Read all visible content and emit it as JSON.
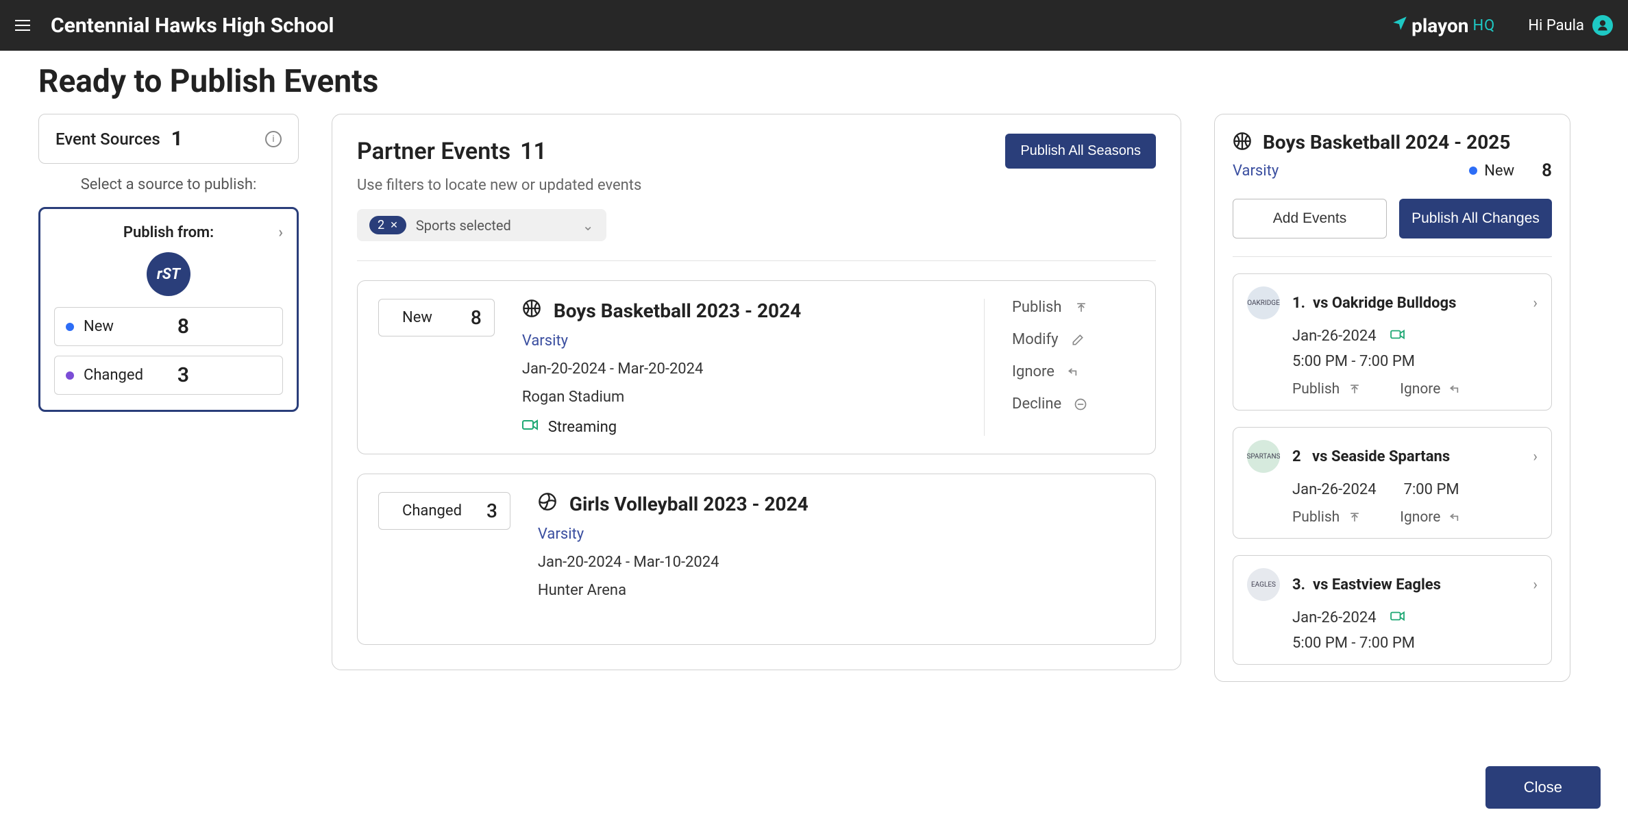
{
  "header": {
    "school": "Centennial Hawks High School",
    "brand_main": "playon",
    "brand_suffix": "HQ",
    "greeting": "Hi Paula"
  },
  "page_title": "Ready to Publish Events",
  "sources_panel": {
    "label": "Event Sources",
    "count": "1",
    "instruction": "Select a source to publish:",
    "publish_from": "Publish from:",
    "source_logo_text": "rST",
    "new_label": "New",
    "new_count": "8",
    "changed_label": "Changed",
    "changed_count": "3"
  },
  "center": {
    "title": "Partner Events",
    "count": "11",
    "publish_all_btn": "Publish All Seasons",
    "subtitle": "Use filters to locate new or updated events",
    "filter_count": "2",
    "filter_label": "Sports selected",
    "events": [
      {
        "status_kind": "new",
        "status_label": "New",
        "status_count": "8",
        "sport": "basketball",
        "title": "Boys Basketball 2023 - 2024",
        "level": "Varsity",
        "dates": "Jan-20-2024 - Mar-20-2024",
        "venue": "Rogan Stadium",
        "streaming": "Streaming",
        "actions": {
          "publish": "Publish",
          "modify": "Modify",
          "ignore": "Ignore",
          "decline": "Decline"
        }
      },
      {
        "status_kind": "changed",
        "status_label": "Changed",
        "status_count": "3",
        "sport": "volleyball",
        "title": "Girls Volleyball 2023 - 2024",
        "level": "Varsity",
        "dates": "Jan-20-2024 - Mar-10-2024",
        "venue": "Hunter Arena"
      }
    ]
  },
  "right": {
    "title": "Boys Basketball 2024 - 2025",
    "level": "Varsity",
    "status_label": "New",
    "count": "8",
    "add_btn": "Add Events",
    "publish_btn": "Publish All Changes",
    "games": [
      {
        "num": "1.",
        "opponent": "vs Oakridge Bulldogs",
        "date": "Jan-26-2024",
        "has_stream": true,
        "time": "5:00 PM - 7:00 PM",
        "publish": "Publish",
        "ignore": "Ignore",
        "badge": "OAKRIDGE"
      },
      {
        "num": "2",
        "opponent": "vs Seaside Spartans",
        "date": "Jan-26-2024",
        "has_stream": false,
        "time": "7:00 PM",
        "publish": "Publish",
        "ignore": "Ignore",
        "badge": "SPARTANS"
      },
      {
        "num": "3.",
        "opponent": "vs Eastview Eagles",
        "date": "Jan-26-2024",
        "has_stream": true,
        "time": "5:00 PM - 7:00 PM",
        "badge": "EAGLES"
      }
    ]
  },
  "footer": {
    "close": "Close"
  }
}
